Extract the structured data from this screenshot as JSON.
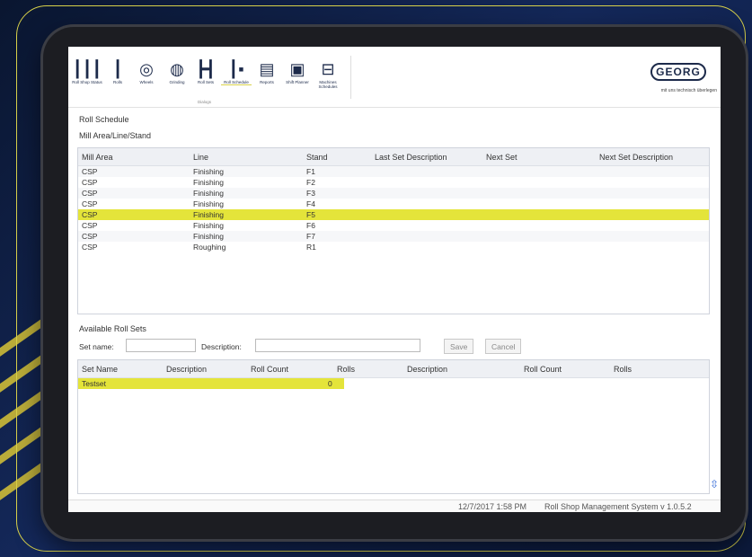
{
  "toolbar": {
    "items": [
      {
        "icon": "bars-icon",
        "glyph": "┃┃┃",
        "label": "Roll Shop Status"
      },
      {
        "icon": "roll-icon",
        "glyph": "┃",
        "label": "Rolls"
      },
      {
        "icon": "wheel-icon",
        "glyph": "◎",
        "label": "Wheels"
      },
      {
        "icon": "grinding-icon",
        "glyph": "◍",
        "label": "Grinding"
      },
      {
        "icon": "roll-set-icon",
        "glyph": "┣┫",
        "label": "Roll Sets"
      },
      {
        "icon": "roll-schedule-icon",
        "glyph": "┃▪",
        "label": "Roll Schedule"
      },
      {
        "icon": "clipboard-icon",
        "glyph": "▤",
        "label": "Reports"
      },
      {
        "icon": "calendar-icon",
        "glyph": "▣",
        "label": "Shift Planner"
      },
      {
        "icon": "machine-icon",
        "glyph": "⊟",
        "label": "Machines Schedules"
      }
    ],
    "group_label": "Dialogs",
    "logo": "GEORG",
    "tagline": "mit uns technisch überlegen"
  },
  "schedule": {
    "title": "Roll Schedule",
    "subtitle": "Mill Area/Line/Stand",
    "columns": [
      "Mill Area",
      "Line",
      "Stand",
      "Last Set Description",
      "Next Set",
      "Next Set Description"
    ],
    "rows": [
      {
        "area": "CSP",
        "line": "Finishing",
        "stand": "F1"
      },
      {
        "area": "CSP",
        "line": "Finishing",
        "stand": "F2"
      },
      {
        "area": "CSP",
        "line": "Finishing",
        "stand": "F3"
      },
      {
        "area": "CSP",
        "line": "Finishing",
        "stand": "F4"
      },
      {
        "area": "CSP",
        "line": "Finishing",
        "stand": "F5"
      },
      {
        "area": "CSP",
        "line": "Finishing",
        "stand": "F6"
      },
      {
        "area": "CSP",
        "line": "Finishing",
        "stand": "F7"
      },
      {
        "area": "CSP",
        "line": "Roughing",
        "stand": "R1"
      }
    ],
    "selected_index": 4
  },
  "rollsets": {
    "title": "Available Roll Sets",
    "set_name_label": "Set name:",
    "set_name_value": "",
    "description_label": "Description:",
    "description_value": "",
    "save_label": "Save",
    "cancel_label": "Cancel",
    "columns": [
      "Set Name",
      "Description",
      "Roll Count",
      "Rolls",
      "Description",
      "Roll Count",
      "Rolls"
    ],
    "rows": [
      {
        "name": "Testset",
        "description": "",
        "count": "",
        "rolls": "0"
      }
    ]
  },
  "status": {
    "datetime": "12/7/2017 1:58 PM",
    "system": "Roll Shop Management System v 1.0.5.2"
  },
  "colors": {
    "highlight": "#e4e43a",
    "frame": "#d9d24a",
    "background": "#0b1a3a"
  }
}
